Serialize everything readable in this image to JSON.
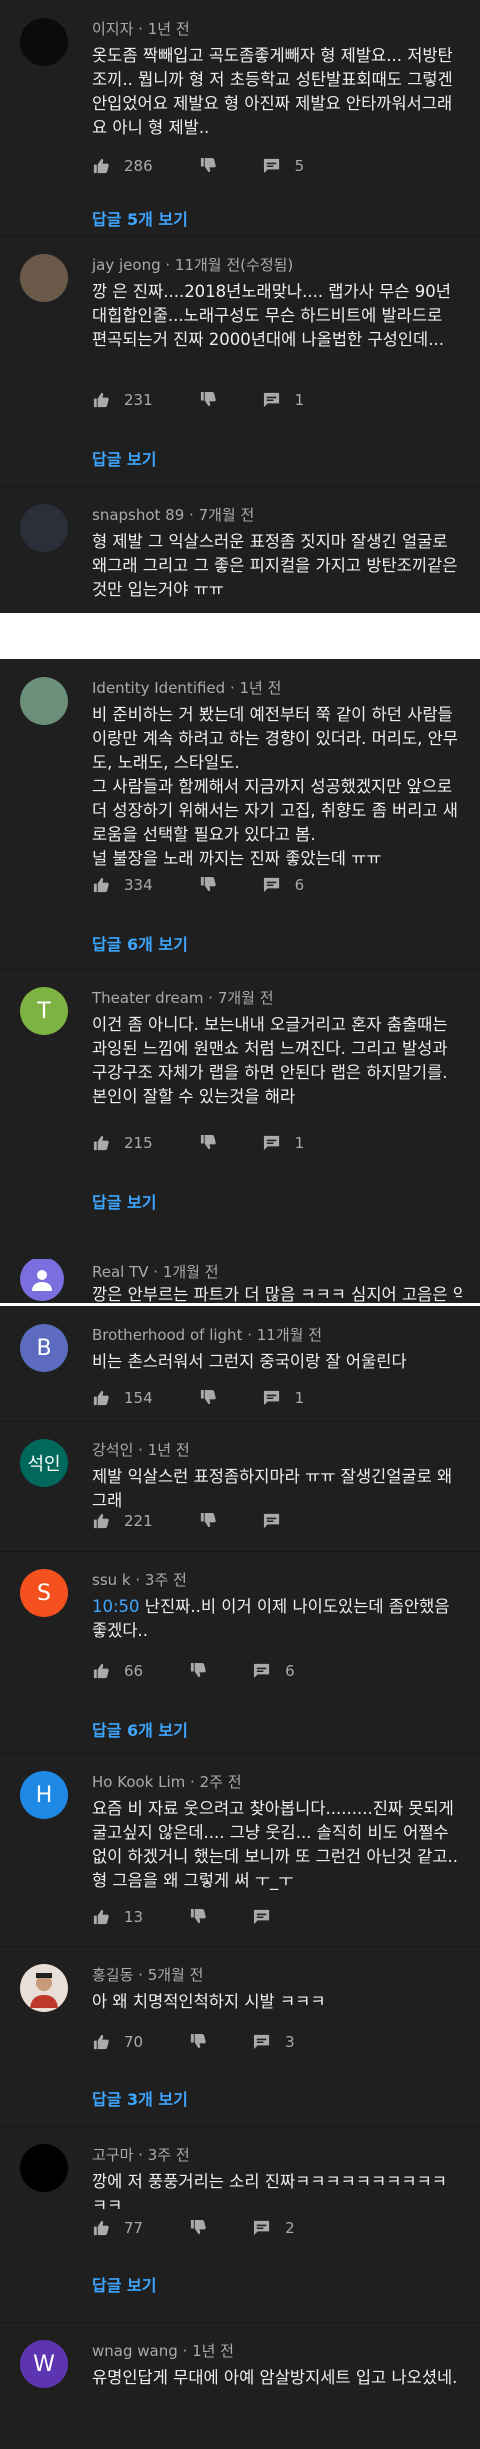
{
  "comments": [
    {
      "author": "이지자",
      "time": "1년 전",
      "text": "옷도좀 짝빼입고 곡도좀좋게빼자 형 제발요... 저방탄조끼.. 뭡니까 형 저 초등학교 성탄발표회때도 그렇겐 안입었어요 제발요 형 아진짜 제발요 안타까워서그래요 아니 형 제발..",
      "likes": "286",
      "replies_count": "5",
      "replies": "답글 5개 보기",
      "avatar_color": "#0b0b0b"
    },
    {
      "author": "jay jeong",
      "time": "11개월 전(수정됨)",
      "text": "깡 은 진짜....2018년노래맞나.... 랩가사 무슨 90년대힙합인줄...노래구성도 무슨 하드비트에 발라드로 편곡되는거 진짜 2000년대에 나올법한 구성인데...",
      "likes": "231",
      "replies_count": "1",
      "replies": "답글 보기",
      "avatar_color": "#6b5a4a"
    },
    {
      "author": "snapshot 89",
      "time": "7개월 전",
      "text": "형 제발 그 익살스러운 표정좀 짓지마 잘생긴 얼굴로 왜그래 그리고 그 좋은 피지컬을 가지고 방탄조끼같은것만 입는거야 ㅠㅠ",
      "avatar_color": "#2a2f3a"
    },
    {
      "author": "Identity Identified",
      "time": "1년 전",
      "text": "비 준비하는 거 봤는데 예전부터 쭉 같이 하던 사람들이랑만 계속 하려고 하는 경향이 있더라. 머리도, 안무도, 노래도, 스타일도.\n그 사람들과 함께해서 지금까지 성공했겠지만 앞으로 더 성장하기 위해서는 자기 고집, 취향도 좀 버리고 새로움을 선택할 필요가 있다고 봄.\n널 불장을 노래 까지는 진짜 좋았는데 ㅠㅠ",
      "likes": "334",
      "replies_count": "6",
      "replies": "답글 6개 보기",
      "avatar_color": "#6b8f7a"
    },
    {
      "author": "Theater dream",
      "time": "7개월 전",
      "text": "이건 좀 아니다. 보는내내 오글거리고 혼자 춤출때는 과잉된 느낌에 원맨쇼 처럼 느껴진다. 그리고 발성과 구강구조 자체가 랩을 하면 안된다 랩은 하지말기를. 본인이 잘할 수 있는것을 해라",
      "likes": "215",
      "replies_count": "1",
      "replies": "답글 보기",
      "avatar_color": "#7cb342",
      "avatar_letter": "T"
    },
    {
      "author": "Real TV",
      "time": "1개월 전",
      "text": "깡은 안부르는 파트가 더 많음 ㅋㅋㅋ 심지어 고음은 익살",
      "avatar_color": "#7b6fe0"
    },
    {
      "author": "Brotherhood of light",
      "time": "11개월 전",
      "text": "비는 촌스러워서 그런지 중국이랑 잘 어울린다",
      "likes": "154",
      "replies_count": "1",
      "avatar_color": "#5c6bc0",
      "avatar_letter": "B"
    },
    {
      "author": "강석인",
      "time": "1년 전",
      "text": "제발 익살스런 표정좀하지마라 ㅠㅠ 잘생긴얼굴로 왜그래",
      "likes": "221",
      "avatar_color": "#00695c",
      "avatar_letter": "석인"
    },
    {
      "author": "ssu k",
      "time": "3주 전",
      "timestamp": "10:50",
      "text": " 난진짜..비 이거 이제 나이도있는데 좀안했음좋겠다..",
      "likes": "66",
      "replies_count": "6",
      "replies": "답글 6개 보기",
      "avatar_color": "#f4511e",
      "avatar_letter": "S"
    },
    {
      "author": "Ho Kook Lim",
      "time": "2주 전",
      "text": "요즘 비 자료 웃으려고 찾아봅니다.........진짜 못되게 굴고싶지 않은데.... 그냥 웃김... 솔직히 비도 어쩔수 없이 하겠거니 했는데 보니까 또 그런건 아닌것 같고.. 형 그음을 왜 그렇게 써 ㅜ_ㅜ",
      "likes": "13",
      "avatar_color": "#1e88e5",
      "avatar_letter": "H"
    },
    {
      "author": "홍길동",
      "time": "5개월 전",
      "text": "아 왜 치명적인척하지 시발 ㅋㅋㅋ",
      "likes": "70",
      "replies_count": "3",
      "replies": "답글 3개 보기",
      "avatar_color": "#e8e0d8"
    },
    {
      "author": "고구마",
      "time": "3주 전",
      "text": "깡에 저 풍풍거리는 소리 진짜ㅋㅋㅋㅋㅋㅋㅋㅋㅋㅋㅋㅋ",
      "likes": "77",
      "replies_count": "2",
      "replies": "답글 보기",
      "avatar_color": "#000000"
    },
    {
      "author": "wnag wang",
      "time": "1년 전",
      "text": "유명인답게 무대에 아예 암살방지세트 입고 나오셨네.",
      "avatar_color": "#5e35b1",
      "avatar_letter": "W"
    }
  ]
}
